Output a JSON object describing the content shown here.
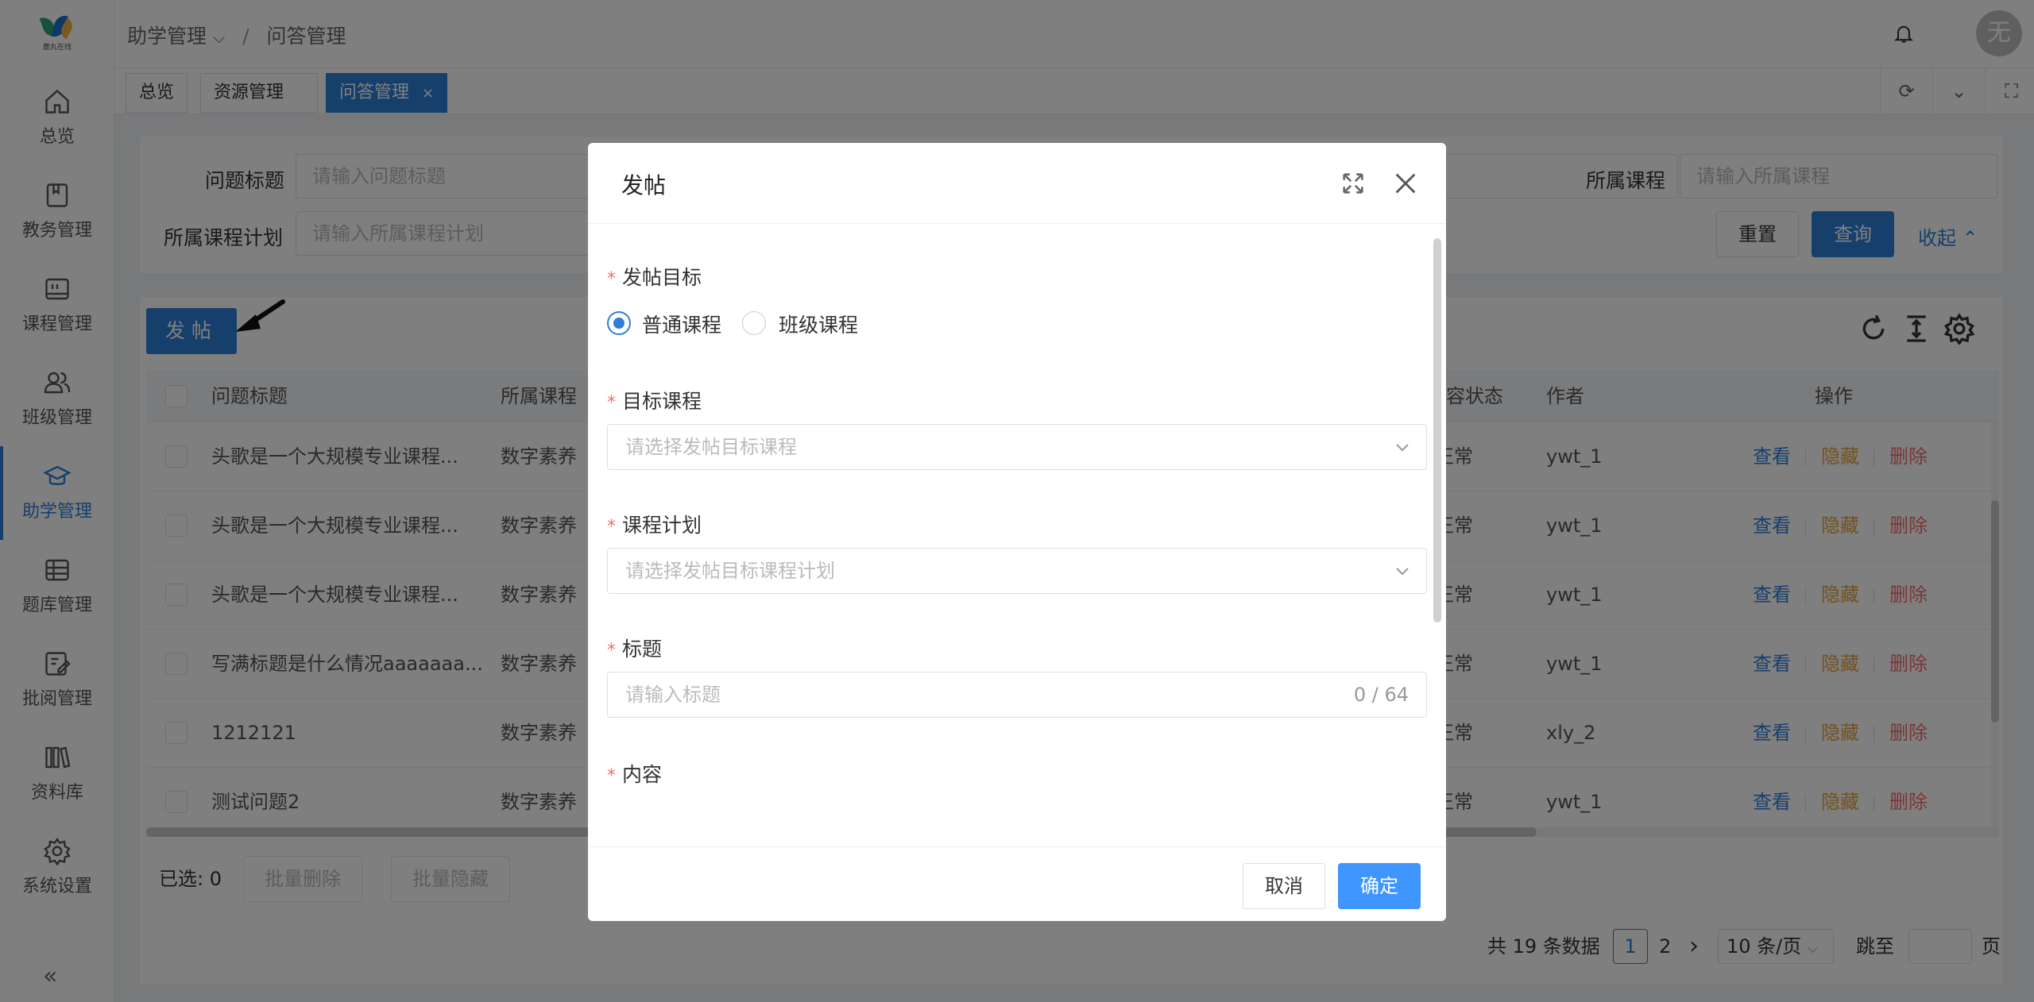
{
  "sidebar": {
    "logo_text": "鹿丸在线",
    "items": [
      {
        "label": "总览",
        "icon": "home-icon"
      },
      {
        "label": "教务管理",
        "icon": "book-icon"
      },
      {
        "label": "课程管理",
        "icon": "course-icon"
      },
      {
        "label": "班级管理",
        "icon": "users-icon"
      },
      {
        "label": "助学管理",
        "icon": "graduation-cap-icon"
      },
      {
        "label": "题库管理",
        "icon": "question-bank-icon"
      },
      {
        "label": "批阅管理",
        "icon": "edit-icon"
      },
      {
        "label": "资料库",
        "icon": "library-icon"
      },
      {
        "label": "系统设置",
        "icon": "gear-icon"
      }
    ],
    "active_index": 4,
    "collapse_label": "«"
  },
  "header": {
    "breadcrumb_parent": "助学管理",
    "breadcrumb_separator": "/",
    "breadcrumb_current": "问答管理",
    "avatar_text": "无"
  },
  "tabs": [
    {
      "label": "总览"
    },
    {
      "label": "资源管理"
    },
    {
      "label": "问答管理",
      "close": "×"
    }
  ],
  "search": {
    "question_title_label": "问题标题",
    "question_title_placeholder": "请输入问题标题",
    "course_label": "所属课程",
    "course_placeholder": "请输入所属课程",
    "plan_label": "所属课程计划",
    "plan_placeholder": "请输入所属课程计划",
    "reset_label": "重置",
    "query_label": "查询",
    "collapse_label": "收起"
  },
  "table": {
    "post_button": "发帖",
    "headers": {
      "title": "问题标题",
      "course": "所属课程",
      "status": "内容状态",
      "author": "作者",
      "ops": "操作"
    },
    "rows": [
      {
        "title": "头歌是一个大规模专业课程...",
        "course": "数字素养",
        "status": "正常",
        "author": "ywt_1"
      },
      {
        "title": "头歌是一个大规模专业课程...",
        "course": "数字素养",
        "status": "正常",
        "author": "ywt_1"
      },
      {
        "title": "头歌是一个大规模专业课程...",
        "course": "数字素养",
        "status": "正常",
        "author": "ywt_1"
      },
      {
        "title": "写满标题是什么情况aaaaaaa...",
        "course": "数字素养",
        "status": "正常",
        "author": "ywt_1"
      },
      {
        "title": "1212121",
        "course": "数字素养",
        "status": "正常",
        "author": "xly_2"
      },
      {
        "title": "测试问题2",
        "course": "数字素养",
        "status": "正常",
        "author": "ywt_1"
      }
    ],
    "op_view": "查看",
    "op_hide": "隐藏",
    "op_delete": "删除",
    "selected_label": "已选: 0",
    "batch_delete": "批量删除",
    "batch_hide": "批量隐藏"
  },
  "pagination": {
    "total_text": "共 19 条数据",
    "pages": [
      "1",
      "2"
    ],
    "current_page": "1",
    "next": "›",
    "page_size": "10 条/页",
    "jump_label": "跳至",
    "page_unit": "页"
  },
  "modal": {
    "title": "发帖",
    "target_label": "发帖目标",
    "target_options": [
      "普通课程",
      "班级课程"
    ],
    "target_selected": 0,
    "course_label": "目标课程",
    "course_placeholder": "请选择发帖目标课程",
    "plan_label": "课程计划",
    "plan_placeholder": "请选择发帖目标课程计划",
    "title_label": "标题",
    "title_placeholder": "请输入标题",
    "title_counter": "0 / 64",
    "content_label": "内容",
    "required_mark": "*",
    "cancel_label": "取消",
    "confirm_label": "确定"
  },
  "colors": {
    "primary": "#2f7ed8",
    "warning": "#e6a23c",
    "danger": "#f56c6c"
  }
}
